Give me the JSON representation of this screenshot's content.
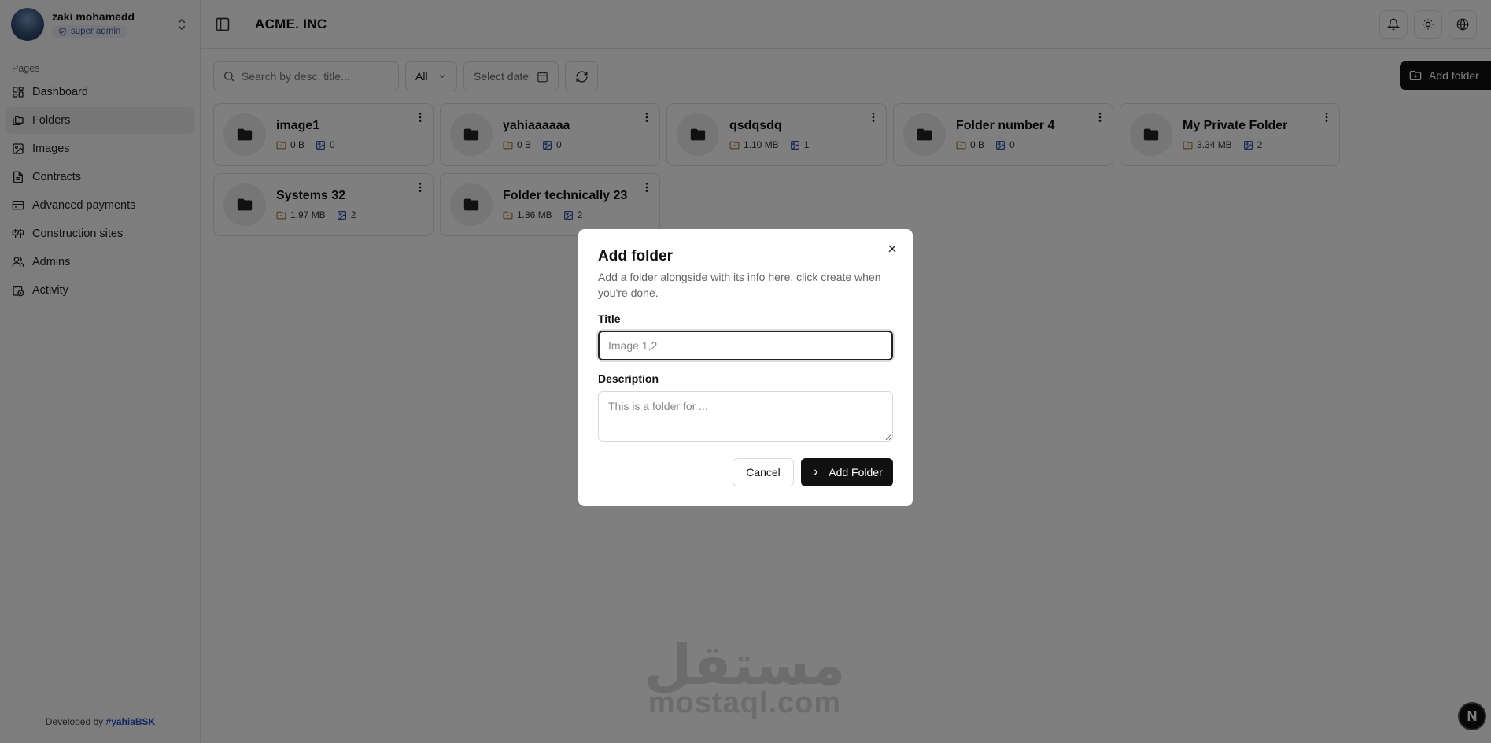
{
  "user": {
    "name": "zaki mohamedd",
    "role": "super admin"
  },
  "sidebar": {
    "section_label": "Pages",
    "items": [
      {
        "label": "Dashboard",
        "icon": "dashboard-icon"
      },
      {
        "label": "Folders",
        "icon": "folders-icon",
        "active": true
      },
      {
        "label": "Images",
        "icon": "images-icon"
      },
      {
        "label": "Contracts",
        "icon": "contracts-icon"
      },
      {
        "label": "Advanced payments",
        "icon": "payments-icon"
      },
      {
        "label": "Construction sites",
        "icon": "construction-icon"
      },
      {
        "label": "Admins",
        "icon": "admins-icon"
      },
      {
        "label": "Activity",
        "icon": "activity-icon"
      }
    ],
    "credit_prefix": "Developed by",
    "credit_handle": "#yahiaBSK"
  },
  "header": {
    "brand": "ACME. INC"
  },
  "toolbar": {
    "search_placeholder": "Search by desc, title...",
    "filter_value": "All",
    "date_placeholder": "Select date",
    "add_folder_label": "Add folder"
  },
  "folders": [
    {
      "title": "image1",
      "size": "0 B",
      "count": "0"
    },
    {
      "title": "yahiaaaaaa",
      "size": "0 B",
      "count": "0"
    },
    {
      "title": "qsdqsdq",
      "size": "1.10 MB",
      "count": "1"
    },
    {
      "title": "Folder number 4",
      "size": "0 B",
      "count": "0"
    },
    {
      "title": "My Private Folder",
      "size": "3.34 MB",
      "count": "2"
    },
    {
      "title": "Systems 32",
      "size": "1.97 MB",
      "count": "2"
    },
    {
      "title": "Folder technically 23",
      "size": "1.86 MB",
      "count": "2"
    }
  ],
  "watermark": {
    "arabic": "مستقل",
    "latin": "mostaql.com"
  },
  "corner_badge": "N",
  "dialog": {
    "title": "Add folder",
    "description": "Add a folder alongside with its info here, click create when you're done.",
    "title_label": "Title",
    "title_placeholder": "Image 1,2",
    "description_label": "Description",
    "description_placeholder": "This is a folder for ...",
    "cancel_label": "Cancel",
    "submit_label": "Add Folder"
  },
  "colors": {
    "accent": "#111111",
    "overlay": "rgba(0,0,0,0.5)",
    "role_badge": "#3f5b94",
    "credit_link": "#2b55c8"
  }
}
